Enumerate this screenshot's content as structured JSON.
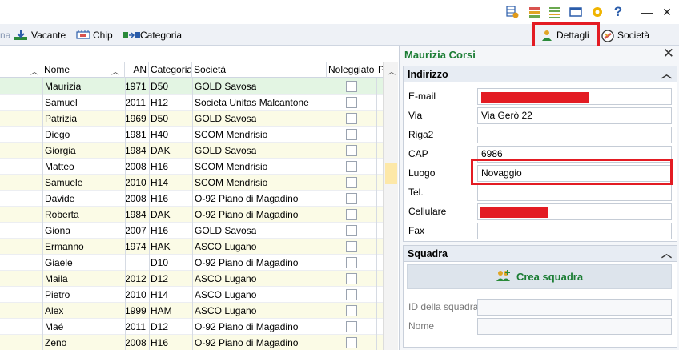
{
  "titlebar": {
    "icons": [
      "grid-settings-icon",
      "columns-icon",
      "list-icon",
      "window-icon",
      "gear-icon"
    ],
    "help": "?",
    "minimize": "—",
    "close": "✕"
  },
  "toolbar": {
    "partial_label": "na",
    "vacante_label": "Vacante",
    "chip_label": "Chip",
    "categoria_label": "Categoria",
    "dettagli_label": "Dettagli",
    "societa_label": "Società",
    "colors": {
      "highlight": "#e31b23",
      "accent_green": "#1b7d34"
    }
  },
  "grid": {
    "columns": [
      "Nome",
      "AN",
      "Categoria",
      "Società",
      "Noleggiato",
      "P"
    ],
    "rows": [
      {
        "nome": "Maurizia",
        "an": "1971",
        "cat": "D50",
        "soc": "GOLD Savosa",
        "bg": "#e3f5e3"
      },
      {
        "nome": "Samuel",
        "an": "2011",
        "cat": "H12",
        "soc": "Societa Unitas Malcantone",
        "bg": "#ffffff"
      },
      {
        "nome": "Patrizia",
        "an": "1969",
        "cat": "D50",
        "soc": "GOLD Savosa",
        "bg": "#fbfbe6"
      },
      {
        "nome": "Diego",
        "an": "1981",
        "cat": "H40",
        "soc": "SCOM Mendrisio",
        "bg": "#ffffff"
      },
      {
        "nome": "Giorgia",
        "an": "1984",
        "cat": "DAK",
        "soc": "GOLD Savosa",
        "bg": "#fbfbe6"
      },
      {
        "nome": "Matteo",
        "an": "2008",
        "cat": "H16",
        "soc": "SCOM Mendrisio",
        "bg": "#ffffff"
      },
      {
        "nome": "Samuele",
        "an": "2010",
        "cat": "H14",
        "soc": "SCOM Mendrisio",
        "bg": "#fbfbe6"
      },
      {
        "nome": "Davide",
        "an": "2008",
        "cat": "H16",
        "soc": "O-92 Piano di Magadino",
        "bg": "#ffffff"
      },
      {
        "nome": "Roberta",
        "an": "1984",
        "cat": "DAK",
        "soc": "O-92 Piano di Magadino",
        "bg": "#fbfbe6"
      },
      {
        "nome": "Giona",
        "an": "2007",
        "cat": "H16",
        "soc": "GOLD Savosa",
        "bg": "#ffffff"
      },
      {
        "nome": "Ermanno",
        "an": "1974",
        "cat": "HAK",
        "soc": "ASCO Lugano",
        "bg": "#fbfbe6"
      },
      {
        "nome": "Giaele",
        "an": "",
        "cat": "D10",
        "soc": "O-92 Piano di Magadino",
        "bg": "#ffffff"
      },
      {
        "nome": "Maila",
        "an": "2012",
        "cat": "D12",
        "soc": "ASCO Lugano",
        "bg": "#fbfbe6"
      },
      {
        "nome": "Pietro",
        "an": "2010",
        "cat": "H14",
        "soc": "ASCO Lugano",
        "bg": "#ffffff"
      },
      {
        "nome": "Alex",
        "an": "1999",
        "cat": "HAM",
        "soc": "ASCO Lugano",
        "bg": "#fbfbe6"
      },
      {
        "nome": "Maé",
        "an": "2011",
        "cat": "D12",
        "soc": "O-92 Piano di Magadino",
        "bg": "#ffffff"
      },
      {
        "nome": "Zeno",
        "an": "2008",
        "cat": "H16",
        "soc": "O-92 Piano di Magadino",
        "bg": "#fbfbe6"
      }
    ]
  },
  "panel": {
    "title": "Maurizia Corsi",
    "close": "✕",
    "indirizzo": {
      "header": "Indirizzo",
      "labels": [
        "E-mail",
        "Via",
        "Riga2",
        "CAP",
        "Luogo",
        "Tel.",
        "Cellulare",
        "Fax"
      ],
      "values": [
        "",
        "Via Gerò 22",
        "",
        "6986",
        "Novaggio",
        "",
        "",
        ""
      ]
    },
    "squadra": {
      "header": "Squadra",
      "crea_label": "Crea squadra",
      "id_label": "ID della squadra",
      "nome_label": "Nome",
      "id_value": "",
      "nome_value": ""
    }
  }
}
